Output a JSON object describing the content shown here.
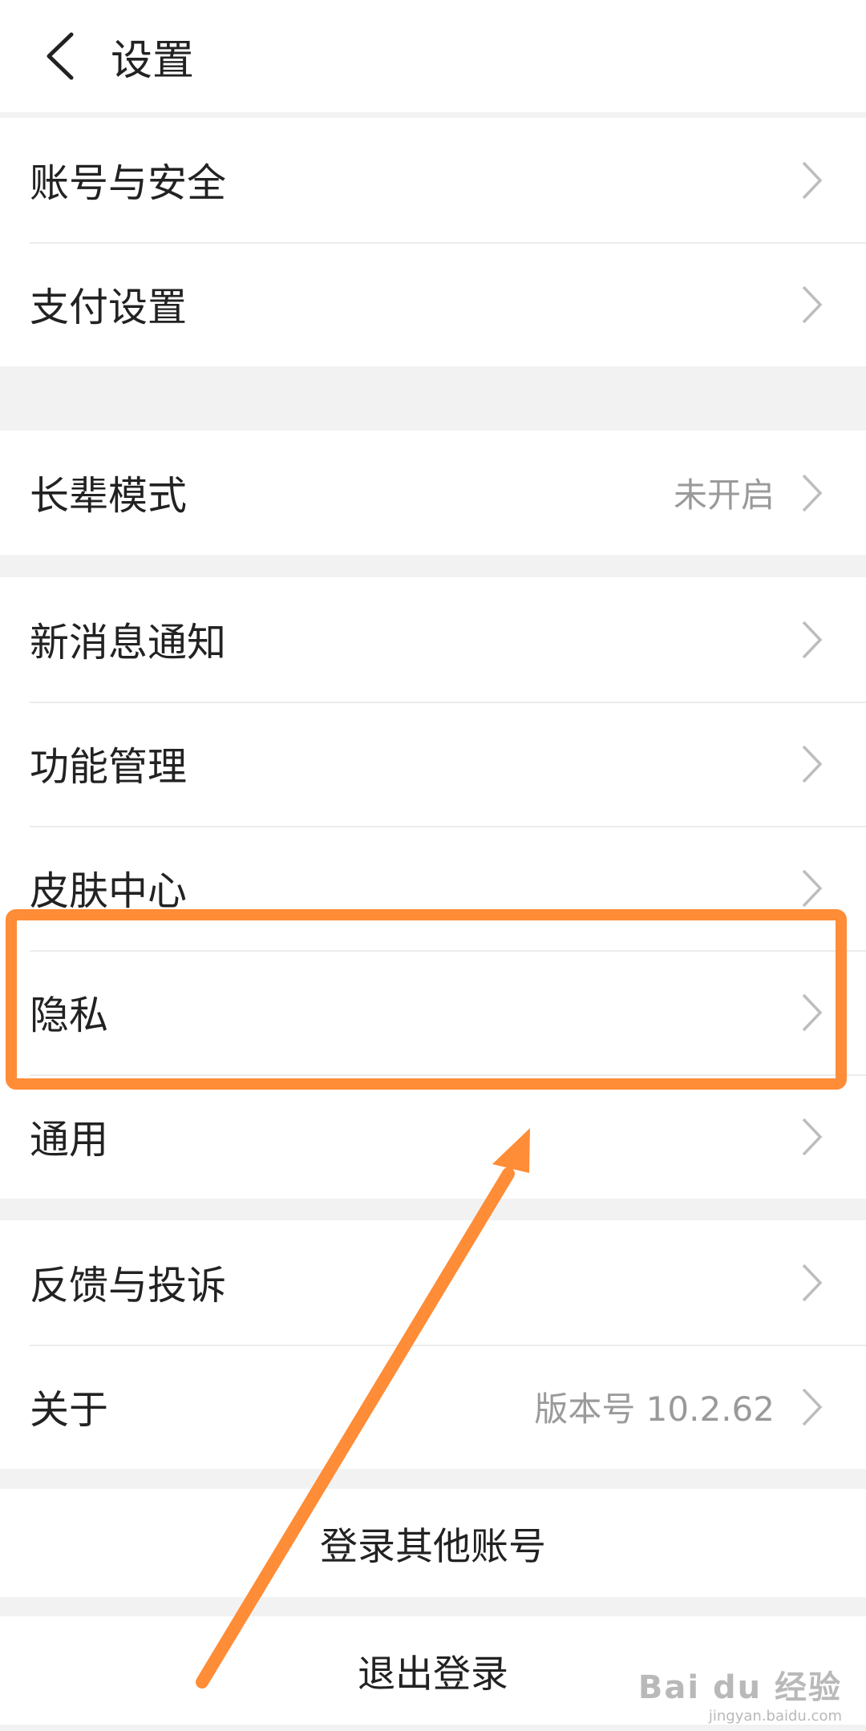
{
  "header": {
    "title": "设置"
  },
  "groups": {
    "g1": [
      {
        "label": "账号与安全"
      },
      {
        "label": "支付设置"
      }
    ],
    "g2": [
      {
        "label": "长辈模式",
        "value": "未开启"
      }
    ],
    "g3": [
      {
        "label": "新消息通知"
      },
      {
        "label": "功能管理"
      },
      {
        "label": "皮肤中心"
      },
      {
        "label": "隐私"
      },
      {
        "label": "通用"
      }
    ],
    "g4": [
      {
        "label": "反馈与投诉"
      },
      {
        "label": "关于",
        "value": "版本号 10.2.62"
      }
    ]
  },
  "actions": {
    "switch_account": "登录其他账号",
    "logout": "退出登录"
  },
  "annotation": {
    "highlight_color": "#ff8c36",
    "highlighted_item": "隐私"
  },
  "watermark": {
    "main": "Bai du 经验",
    "sub": "jingyan.baidu.com"
  },
  "icons": {
    "back": "back-arrow-icon",
    "chevron": "chevron-right-icon"
  }
}
